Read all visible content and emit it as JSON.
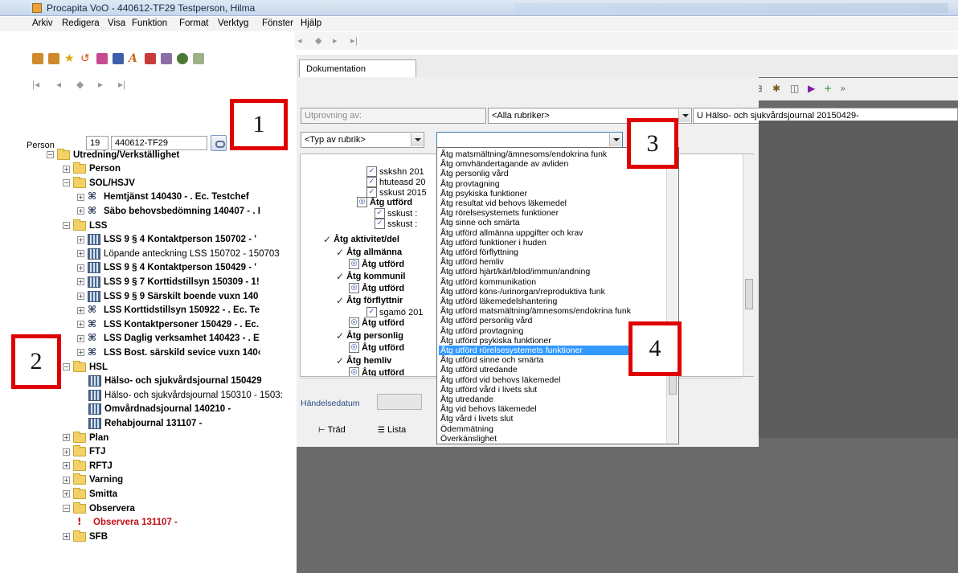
{
  "window": {
    "title": "Procapita VoO - 440612-TF29 Testperson, Hilma"
  },
  "menu": [
    "Arkiv",
    "Redigera",
    "Visa",
    "Funktion",
    "Format",
    "Verktyg",
    "Fönster",
    "Hjälp"
  ],
  "person": {
    "label": "Person",
    "number": "19",
    "id": "440612-TF29"
  },
  "tree": [
    {
      "label": "Utredning/Verkställighet",
      "bold": true,
      "icon": "folder-icon",
      "expander": "−"
    },
    {
      "label": "Person",
      "bold": true,
      "icon": "folder-icon",
      "expander": "+"
    },
    {
      "label": "SOL/HSJV",
      "bold": true,
      "icon": "folder-icon",
      "expander": "−"
    },
    {
      "label": "Hemtjänst 140430 - . Ec. Testchef",
      "bold": true,
      "icon": "team-icon",
      "expander": "+"
    },
    {
      "label": "Säbo behovsbedömning 140407 - . I",
      "bold": true,
      "icon": "team-icon",
      "expander": "+"
    },
    {
      "label": "LSS",
      "bold": true,
      "icon": "folder-icon",
      "expander": "−"
    },
    {
      "label": "LSS 9 § 4 Kontaktperson 150702 - '",
      "bold": true,
      "icon": "document-icon",
      "expander": "+"
    },
    {
      "label": "Löpande anteckning LSS 150702 - 150703",
      "bold": false,
      "icon": "document-icon",
      "expander": "+"
    },
    {
      "label": "LSS 9 § 4 Kontaktperson 150429 - '",
      "bold": true,
      "icon": "document-icon",
      "expander": "+"
    },
    {
      "label": "LSS 9 § 7 Korttidstillsyn 150309 - 1!",
      "bold": true,
      "icon": "document-icon",
      "expander": "+"
    },
    {
      "label": "LSS 9 § 9 Särskilt boende vuxn 140",
      "bold": true,
      "icon": "document-icon",
      "expander": "+"
    },
    {
      "label": "LSS Korttidstillsyn 150922 - . Ec. Te",
      "bold": true,
      "icon": "team-icon",
      "expander": "+"
    },
    {
      "label": "LSS Kontaktpersoner 150429 - . Ec.",
      "bold": true,
      "icon": "team-icon",
      "expander": "+"
    },
    {
      "label": "LSS Daglig verksamhet 140423 - . E",
      "bold": true,
      "icon": "team-icon",
      "expander": "+"
    },
    {
      "label": "LSS Bost. särskild sevice vuxn 140‹",
      "bold": true,
      "icon": "team-icon",
      "expander": "+"
    },
    {
      "label": "HSL",
      "bold": true,
      "icon": "folder-icon",
      "expander": "−"
    },
    {
      "label": "Hälso- och sjukvårdsjournal 150429",
      "bold": true,
      "icon": "document-icon",
      "expander": ""
    },
    {
      "label": "Hälso- och sjukvårdsjournal 150310 - 1503:",
      "bold": false,
      "icon": "document-icon",
      "expander": ""
    },
    {
      "label": "Omvårdnadsjournal 140210 -",
      "bold": true,
      "icon": "document-icon",
      "expander": ""
    },
    {
      "label": "Rehabjournal 131107 -",
      "bold": true,
      "icon": "document-icon",
      "expander": ""
    },
    {
      "label": "Plan",
      "bold": true,
      "icon": "folder-icon",
      "expander": "+"
    },
    {
      "label": "FTJ",
      "bold": true,
      "icon": "folder-icon",
      "expander": "+"
    },
    {
      "label": "RFTJ",
      "bold": true,
      "icon": "folder-icon",
      "expander": "+"
    },
    {
      "label": "Varning",
      "bold": true,
      "icon": "folder-icon",
      "expander": "+"
    },
    {
      "label": "Smitta",
      "bold": true,
      "icon": "folder-icon",
      "expander": "+"
    },
    {
      "label": "Observera",
      "bold": true,
      "icon": "folder-icon",
      "expander": "−"
    },
    {
      "label": "Observera 131107 -",
      "bold": true,
      "red": true,
      "icon": "exclamation-icon",
      "expander": ""
    },
    {
      "label": "SFB",
      "bold": true,
      "icon": "folder-icon",
      "expander": "+"
    }
  ],
  "tabs": {
    "documentation": "Dokumentation"
  },
  "format_toolbar": {
    "font_size": "8"
  },
  "filters": {
    "utprovning_label": "Utprovning av:",
    "rubriker": "<Alla rubriker>",
    "journal": "U Hälso- och sjukvårdsjournal 20150429-",
    "typ_av_rubrik": "<Typ av rubrik>",
    "selected_keyword": ""
  },
  "inner_tree": [
    {
      "label": "sskshn 201",
      "bold": false,
      "mark": "check"
    },
    {
      "label": "htuteasd 20",
      "bold": false,
      "mark": "check"
    },
    {
      "label": "sskust 2015",
      "bold": false,
      "mark": "check"
    },
    {
      "label": "Åtg utförd",
      "bold": true,
      "mark": "circle"
    },
    {
      "label": "sskust :",
      "bold": false,
      "mark": "check"
    },
    {
      "label": "sskust :",
      "bold": false,
      "mark": "check"
    },
    {
      "label": "Åtg aktivitet/del",
      "bold": true,
      "mark": "tick"
    },
    {
      "label": "Åtg allmänna",
      "bold": true,
      "mark": "tick"
    },
    {
      "label": "Åtg utförd",
      "bold": true,
      "mark": "circle"
    },
    {
      "label": "Åtg kommunil",
      "bold": true,
      "mark": "tick"
    },
    {
      "label": "Åtg utförd",
      "bold": true,
      "mark": "circle"
    },
    {
      "label": "Åtg förflyttnir",
      "bold": true,
      "mark": "tick"
    },
    {
      "label": "sgamö 201",
      "bold": false,
      "mark": "check"
    },
    {
      "label": "Åtg utförd",
      "bold": true,
      "mark": "circle"
    },
    {
      "label": "Åtg personlig",
      "bold": true,
      "mark": "tick"
    },
    {
      "label": "Åtg utförd",
      "bold": true,
      "mark": "circle"
    },
    {
      "label": "Åtg hemliv",
      "bold": true,
      "mark": "tick"
    },
    {
      "label": "Åtg utförd",
      "bold": true,
      "mark": "circle"
    }
  ],
  "dropdown": {
    "items": [
      "Åtg matsmältning/ämnesoms/endokrina funk",
      "Åtg omvhändertagande av avliden",
      "Åtg personlig vård",
      "Åtg provtagning",
      "Åtg psykiska funktioner",
      "Åtg resultat vid behovs läkemedel",
      "Åtg rörelsesystemets funktioner",
      "Åtg sinne och smärta",
      "Åtg utförd allmänna uppgifter och krav",
      "Åtg utförd funktioner i huden",
      "Åtg utförd förflyttning",
      "Åtg utförd hemliv",
      "Åtg utförd hjärt/kärl/blod/immun/andning",
      "Åtg utförd kommunikation",
      "Åtg utförd köns-/urinorgan/reproduktiva funk",
      "Åtg utförd läkemedelshantering",
      "Åtg utförd matsmältning/ämnesoms/endokrina funk",
      "Åtg utförd personlig vård",
      "Åtg utförd provtagning",
      "Åtg utförd psykiska funktioner",
      "Åtg utförd rörelsesystemets funktioner",
      "Åtg utförd sinne och smärta",
      "Åtg utförd utredande",
      "Åtg utförd vid behovs läkemedel",
      "Åtg utförd vård i livets slut",
      "Åtg utredande",
      "Åtg vid behovs läkemedel",
      "Åtg vård i livets slut",
      "Ödemmätning",
      "Överkänslighet"
    ],
    "selected_index": 20
  },
  "handelsedatum": {
    "label": "Händelsedatum"
  },
  "bottom_tabs": [
    "Träd",
    "Lista"
  ],
  "callouts": [
    "1",
    "2",
    "3",
    "4"
  ],
  "colors": {
    "callout_border": "#e00000",
    "selection": "#3399ff",
    "folder": "#f2d167",
    "alert_text": "#c0101a"
  }
}
